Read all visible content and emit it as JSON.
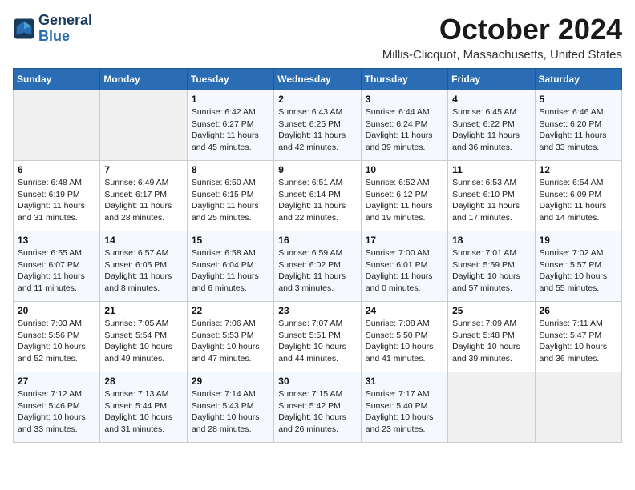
{
  "logo": {
    "line1": "General",
    "line2": "Blue"
  },
  "title": "October 2024",
  "subtitle": "Millis-Clicquot, Massachusetts, United States",
  "weekdays": [
    "Sunday",
    "Monday",
    "Tuesday",
    "Wednesday",
    "Thursday",
    "Friday",
    "Saturday"
  ],
  "weeks": [
    [
      {
        "day": null,
        "info": null
      },
      {
        "day": null,
        "info": null
      },
      {
        "day": "1",
        "info": "Sunrise: 6:42 AM\nSunset: 6:27 PM\nDaylight: 11 hours and 45 minutes."
      },
      {
        "day": "2",
        "info": "Sunrise: 6:43 AM\nSunset: 6:25 PM\nDaylight: 11 hours and 42 minutes."
      },
      {
        "day": "3",
        "info": "Sunrise: 6:44 AM\nSunset: 6:24 PM\nDaylight: 11 hours and 39 minutes."
      },
      {
        "day": "4",
        "info": "Sunrise: 6:45 AM\nSunset: 6:22 PM\nDaylight: 11 hours and 36 minutes."
      },
      {
        "day": "5",
        "info": "Sunrise: 6:46 AM\nSunset: 6:20 PM\nDaylight: 11 hours and 33 minutes."
      }
    ],
    [
      {
        "day": "6",
        "info": "Sunrise: 6:48 AM\nSunset: 6:19 PM\nDaylight: 11 hours and 31 minutes."
      },
      {
        "day": "7",
        "info": "Sunrise: 6:49 AM\nSunset: 6:17 PM\nDaylight: 11 hours and 28 minutes."
      },
      {
        "day": "8",
        "info": "Sunrise: 6:50 AM\nSunset: 6:15 PM\nDaylight: 11 hours and 25 minutes."
      },
      {
        "day": "9",
        "info": "Sunrise: 6:51 AM\nSunset: 6:14 PM\nDaylight: 11 hours and 22 minutes."
      },
      {
        "day": "10",
        "info": "Sunrise: 6:52 AM\nSunset: 6:12 PM\nDaylight: 11 hours and 19 minutes."
      },
      {
        "day": "11",
        "info": "Sunrise: 6:53 AM\nSunset: 6:10 PM\nDaylight: 11 hours and 17 minutes."
      },
      {
        "day": "12",
        "info": "Sunrise: 6:54 AM\nSunset: 6:09 PM\nDaylight: 11 hours and 14 minutes."
      }
    ],
    [
      {
        "day": "13",
        "info": "Sunrise: 6:55 AM\nSunset: 6:07 PM\nDaylight: 11 hours and 11 minutes."
      },
      {
        "day": "14",
        "info": "Sunrise: 6:57 AM\nSunset: 6:05 PM\nDaylight: 11 hours and 8 minutes."
      },
      {
        "day": "15",
        "info": "Sunrise: 6:58 AM\nSunset: 6:04 PM\nDaylight: 11 hours and 6 minutes."
      },
      {
        "day": "16",
        "info": "Sunrise: 6:59 AM\nSunset: 6:02 PM\nDaylight: 11 hours and 3 minutes."
      },
      {
        "day": "17",
        "info": "Sunrise: 7:00 AM\nSunset: 6:01 PM\nDaylight: 11 hours and 0 minutes."
      },
      {
        "day": "18",
        "info": "Sunrise: 7:01 AM\nSunset: 5:59 PM\nDaylight: 10 hours and 57 minutes."
      },
      {
        "day": "19",
        "info": "Sunrise: 7:02 AM\nSunset: 5:57 PM\nDaylight: 10 hours and 55 minutes."
      }
    ],
    [
      {
        "day": "20",
        "info": "Sunrise: 7:03 AM\nSunset: 5:56 PM\nDaylight: 10 hours and 52 minutes."
      },
      {
        "day": "21",
        "info": "Sunrise: 7:05 AM\nSunset: 5:54 PM\nDaylight: 10 hours and 49 minutes."
      },
      {
        "day": "22",
        "info": "Sunrise: 7:06 AM\nSunset: 5:53 PM\nDaylight: 10 hours and 47 minutes."
      },
      {
        "day": "23",
        "info": "Sunrise: 7:07 AM\nSunset: 5:51 PM\nDaylight: 10 hours and 44 minutes."
      },
      {
        "day": "24",
        "info": "Sunrise: 7:08 AM\nSunset: 5:50 PM\nDaylight: 10 hours and 41 minutes."
      },
      {
        "day": "25",
        "info": "Sunrise: 7:09 AM\nSunset: 5:48 PM\nDaylight: 10 hours and 39 minutes."
      },
      {
        "day": "26",
        "info": "Sunrise: 7:11 AM\nSunset: 5:47 PM\nDaylight: 10 hours and 36 minutes."
      }
    ],
    [
      {
        "day": "27",
        "info": "Sunrise: 7:12 AM\nSunset: 5:46 PM\nDaylight: 10 hours and 33 minutes."
      },
      {
        "day": "28",
        "info": "Sunrise: 7:13 AM\nSunset: 5:44 PM\nDaylight: 10 hours and 31 minutes."
      },
      {
        "day": "29",
        "info": "Sunrise: 7:14 AM\nSunset: 5:43 PM\nDaylight: 10 hours and 28 minutes."
      },
      {
        "day": "30",
        "info": "Sunrise: 7:15 AM\nSunset: 5:42 PM\nDaylight: 10 hours and 26 minutes."
      },
      {
        "day": "31",
        "info": "Sunrise: 7:17 AM\nSunset: 5:40 PM\nDaylight: 10 hours and 23 minutes."
      },
      {
        "day": null,
        "info": null
      },
      {
        "day": null,
        "info": null
      }
    ]
  ]
}
